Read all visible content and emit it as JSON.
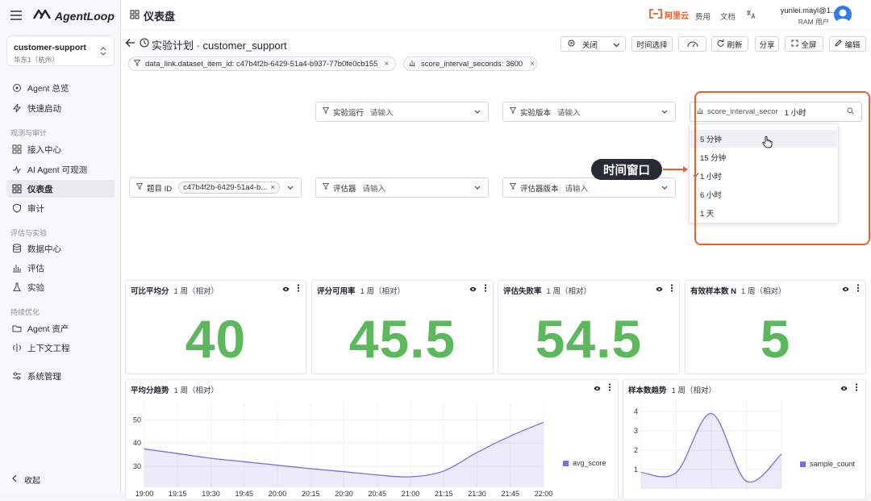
{
  "app": {
    "name": "AgentLoop"
  },
  "project": {
    "name": "customer-support",
    "region": "华东1（杭州）"
  },
  "sidebar": {
    "items": [
      {
        "label": "Agent 总览"
      },
      {
        "label": "快速启动"
      },
      {
        "label": "接入中心"
      },
      {
        "label": "AI Agent 可观测"
      },
      {
        "label": "仪表盘"
      },
      {
        "label": "审计"
      },
      {
        "label": "数据中心"
      },
      {
        "label": "评估"
      },
      {
        "label": "实验"
      },
      {
        "label": "Agent 资产"
      },
      {
        "label": "上下文工程"
      },
      {
        "label": "系统管理"
      }
    ],
    "groups": [
      "观测与审计",
      "评估与实验",
      "持续优化"
    ],
    "collapse_label": "收起"
  },
  "header": {
    "title": "仪表盘",
    "brand": "阿里云",
    "links": [
      "费用",
      "文档"
    ],
    "user_name": "yunlei.mayl@1...",
    "user_role": "RAM 用户"
  },
  "toolbar": {
    "page_title": "实验计划 · customer_support",
    "refresh_select": "关闭",
    "time_select": "时间选择",
    "refresh": "刷新",
    "share": "分享",
    "fullscreen": "全屏",
    "edit": "编辑"
  },
  "chips": [
    {
      "text": "data_link.dataset_item_id: c47b4f2b-6429-51a4-b937-77b0fe0cb155"
    },
    {
      "text": "score_interval_seconds: 3600"
    }
  ],
  "filters": {
    "run": {
      "label": "实验运行",
      "placeholder": "请输入"
    },
    "version": {
      "label": "实验版本",
      "placeholder": "请输入"
    },
    "interval": {
      "label": "score_interval_secor",
      "value": "1 小时"
    },
    "item": {
      "label": "题目 ID",
      "tag": "c47b4f2b-6429-51a4-b..."
    },
    "evaluator": {
      "label": "评估器",
      "placeholder": "请输入"
    },
    "evaluator_version": {
      "label": "评估器版本",
      "placeholder": "请输入"
    }
  },
  "dropdown": {
    "options": [
      "5 分钟",
      "15 分钟",
      "1 小时",
      "6 小时",
      "1 天"
    ],
    "selected": "1 小时",
    "hovered": "5 分钟"
  },
  "annotation": {
    "text": "时间窗口",
    "color": "#e8612c"
  },
  "stats": [
    {
      "title": "可比平均分",
      "range": "1 周（相对）",
      "value": "40"
    },
    {
      "title": "评分可用率",
      "range": "1 周（相对）",
      "value": "45.5"
    },
    {
      "title": "评估失败率",
      "range": "1 周（相对）",
      "value": "54.5"
    },
    {
      "title": "有效样本数 N",
      "range": "1 周（相对）",
      "value": "5"
    }
  ],
  "colors": {
    "stat_green": "#5cb85c",
    "series": "#7b6fe0",
    "accent_orange": "#e8612c"
  },
  "chart_data": [
    {
      "type": "area",
      "title": "平均分趋势",
      "subtitle": "1 周（相对）",
      "x": [
        "19:00",
        "19:15",
        "19:30",
        "19:45",
        "20:00",
        "20:15",
        "20:30",
        "20:45",
        "21:00",
        "21:15",
        "21:30",
        "21:45",
        "22:00"
      ],
      "series": [
        {
          "name": "avg_score",
          "values": [
            37.5,
            35.5,
            33.5,
            32,
            30.5,
            29,
            27.7,
            26.3,
            25.5,
            28,
            36,
            43,
            49
          ]
        }
      ],
      "y_ticks": [
        30,
        40,
        50
      ],
      "ylim": [
        21,
        55
      ],
      "legend": "right"
    },
    {
      "type": "area",
      "title": "样本数趋势",
      "subtitle": "1 周（相对）",
      "series": [
        {
          "name": "sample_count",
          "values": [
            0.85,
            0.85,
            3.9,
            0.4,
            1.8
          ]
        }
      ],
      "y_ticks": [
        1,
        2,
        3,
        4
      ],
      "ylim": [
        0,
        4.3
      ],
      "legend": "right"
    }
  ]
}
